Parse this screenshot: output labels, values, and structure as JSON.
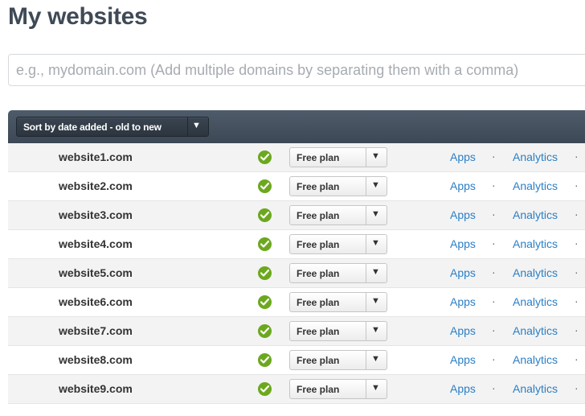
{
  "page_title": "My websites",
  "domain_input": {
    "placeholder": "e.g., mydomain.com (Add multiple domains by separating them with a comma)",
    "value": ""
  },
  "sort": {
    "label": "Sort by date added - old to new",
    "arrow": "▼"
  },
  "icons": {
    "status": "check-circle-icon",
    "dropdown": "triangle-down-icon"
  },
  "colors": {
    "header_bg": "#465260",
    "check": "#6ca81e",
    "link": "#2b7fc5",
    "title": "#3f4a56"
  },
  "separator": "·",
  "websites": [
    {
      "domain": "website1.com",
      "plan": "Free plan",
      "apps": "Apps",
      "analytics": "Analytics"
    },
    {
      "domain": "website2.com",
      "plan": "Free plan",
      "apps": "Apps",
      "analytics": "Analytics"
    },
    {
      "domain": "website3.com",
      "plan": "Free plan",
      "apps": "Apps",
      "analytics": "Analytics"
    },
    {
      "domain": "website4.com",
      "plan": "Free plan",
      "apps": "Apps",
      "analytics": "Analytics"
    },
    {
      "domain": "website5.com",
      "plan": "Free plan",
      "apps": "Apps",
      "analytics": "Analytics"
    },
    {
      "domain": "website6.com",
      "plan": "Free plan",
      "apps": "Apps",
      "analytics": "Analytics"
    },
    {
      "domain": "website7.com",
      "plan": "Free plan",
      "apps": "Apps",
      "analytics": "Analytics"
    },
    {
      "domain": "website8.com",
      "plan": "Free plan",
      "apps": "Apps",
      "analytics": "Analytics"
    },
    {
      "domain": "website9.com",
      "plan": "Free plan",
      "apps": "Apps",
      "analytics": "Analytics"
    }
  ]
}
